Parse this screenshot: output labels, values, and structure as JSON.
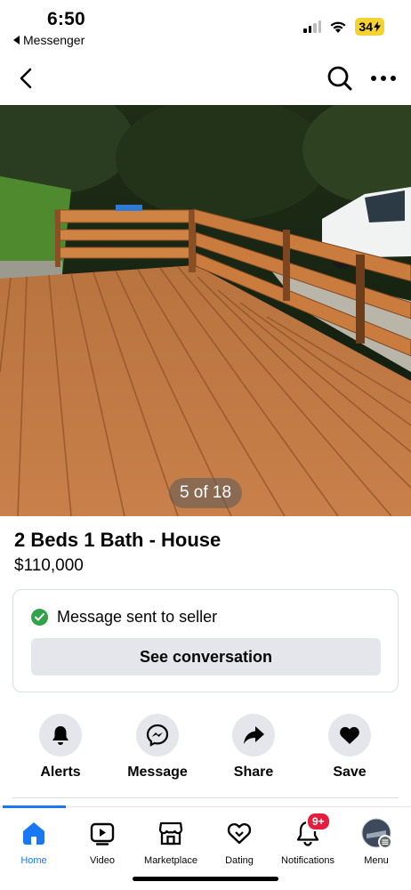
{
  "status_bar": {
    "time": "6:50",
    "back_app": "Messenger",
    "battery": "34"
  },
  "photo": {
    "counter": "5 of 18"
  },
  "listing": {
    "title": "2 Beds 1 Bath - House",
    "price": "$110,000"
  },
  "message_card": {
    "status": "Message sent to seller",
    "button": "See conversation"
  },
  "actions": [
    {
      "label": "Alerts",
      "icon": "bell-icon"
    },
    {
      "label": "Message",
      "icon": "messenger-icon"
    },
    {
      "label": "Share",
      "icon": "share-icon"
    },
    {
      "label": "Save",
      "icon": "heart-icon"
    }
  ],
  "tabbar": {
    "tabs": [
      {
        "label": "Home",
        "icon": "home-icon",
        "active": true
      },
      {
        "label": "Video",
        "icon": "video-icon"
      },
      {
        "label": "Marketplace",
        "icon": "marketplace-icon"
      },
      {
        "label": "Dating",
        "icon": "dating-icon"
      },
      {
        "label": "Notifications",
        "icon": "bell-icon",
        "badge": "9+"
      },
      {
        "label": "Menu",
        "icon": "avatar"
      }
    ]
  },
  "colors": {
    "accent": "#1877f2",
    "badge": "#e41e3f",
    "success": "#31a24c",
    "button_bg": "#e4e6eb"
  }
}
